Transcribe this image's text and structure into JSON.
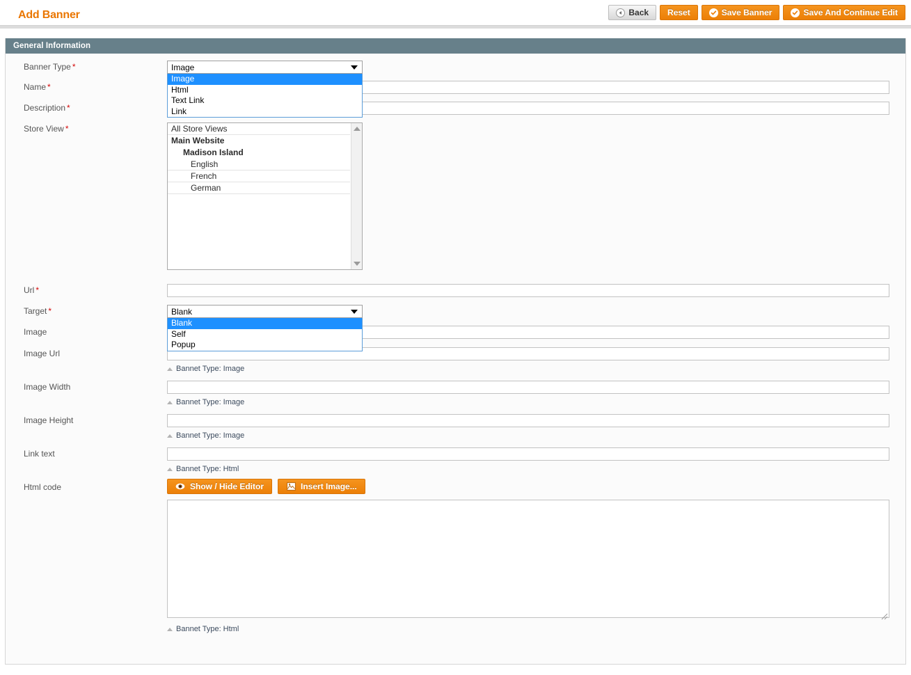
{
  "header": {
    "title": "Add Banner",
    "buttons": [
      {
        "label": "Back",
        "style": "grey",
        "icon": "back-arrow-icon"
      },
      {
        "label": "Reset",
        "style": "orange",
        "icon": "none"
      },
      {
        "label": "Save Banner",
        "style": "orange",
        "icon": "check-icon"
      },
      {
        "label": "Save And Continue Edit",
        "style": "orange",
        "icon": "check-icon"
      }
    ]
  },
  "panel": {
    "title": "General Information"
  },
  "form": {
    "banner_type": {
      "label": "Banner Type",
      "required": "*",
      "value": "Image",
      "open": true,
      "options": [
        "Image",
        "Html",
        "Text Link",
        "Link"
      ],
      "selected_index": 0
    },
    "name": {
      "label": "Name",
      "required": "*",
      "value": "",
      "placeholder": ""
    },
    "description": {
      "label": "Description",
      "required": "*",
      "value": "",
      "placeholder": ""
    },
    "store_view": {
      "label": "Store View",
      "required": "*",
      "options": [
        {
          "text": "All Store Views",
          "level": 0
        },
        {
          "text": "Main Website",
          "level": 1
        },
        {
          "text": "Madison Island",
          "level": 2
        },
        {
          "text": "English",
          "level": 3
        },
        {
          "text": "French",
          "level": 3
        },
        {
          "text": "German",
          "level": 3
        }
      ]
    },
    "url": {
      "label": "Url",
      "required": "*",
      "value": "",
      "placeholder": ""
    },
    "target": {
      "label": "Target",
      "required": "*",
      "value": "Blank",
      "open": true,
      "options": [
        "Blank",
        "Self",
        "Popup"
      ],
      "selected_index": 0
    },
    "image": {
      "label": "Image",
      "required": "",
      "value": ""
    },
    "image_url": {
      "label": "Image Url",
      "required": "",
      "value": "",
      "hint": "Bannet Type: Image"
    },
    "image_width": {
      "label": "Image Width",
      "required": "",
      "value": "",
      "hint": "Bannet Type: Image"
    },
    "image_height": {
      "label": "Image Height",
      "required": "",
      "value": "",
      "hint": "Bannet Type: Image"
    },
    "link_text": {
      "label": "Link text",
      "required": "",
      "value": "",
      "hint": "Bannet Type: Html"
    },
    "html_code": {
      "label": "Html code",
      "value": "",
      "hint": "Bannet Type: Html",
      "show_hide_editor_label": "Show / Hide Editor",
      "insert_image_label": "Insert Image..."
    }
  },
  "colors": {
    "accent_orange": "#ea7601",
    "panel_header": "#67808a",
    "highlight_blue": "#1e90ff",
    "required_red": "#d40707"
  }
}
